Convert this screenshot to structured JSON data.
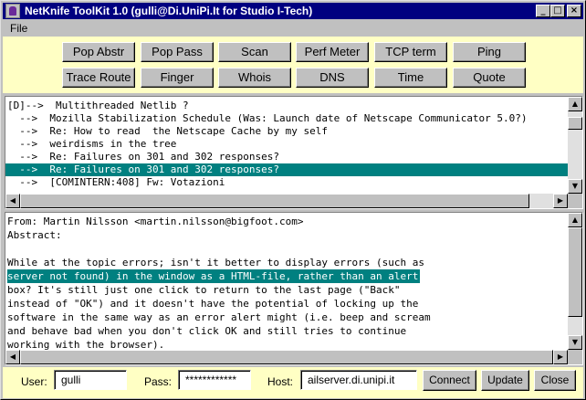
{
  "window": {
    "title": "NetKnife ToolKit 1.0 (gulli@Di.UniPi.It for Studio I-Tech)",
    "minimize_glyph": "_",
    "maximize_glyph": "□",
    "close_glyph": "×"
  },
  "menu": {
    "file": "File"
  },
  "toolbar": {
    "row1": [
      "Pop Abstr",
      "Pop Pass",
      "Scan",
      "Perf Meter",
      "TCP term",
      "Ping"
    ],
    "row2": [
      "Trace Route",
      "Finger",
      "Whois",
      "DNS",
      "Time",
      "Quote"
    ]
  },
  "message_list": {
    "selected_index": 5,
    "items": [
      "[D]-->  Multithreaded Netlib ?",
      "  -->  Mozilla Stabilization Schedule (Was: Launch date of Netscape Communicator 5.0?)",
      "  -->  Re: How to read  the Netscape Cache by my self",
      "  -->  weirdisms in the tree",
      "  -->  Re: Failures on 301 and 302 responses?",
      "  -->  Re: Failures on 301 and 302 responses?",
      "  -->  [COMINTERN:408] Fw: Votazioni"
    ]
  },
  "message_body": {
    "lines": [
      "From: Martin Nilsson <martin.nilsson@bigfoot.com>",
      "Abstract:",
      "",
      "While at the topic errors; isn't it better to display errors (such as",
      "server not found) in the window as a HTML-file, rather than an alert",
      "box? It's still just one click to return to the last page (\"Back\"",
      "instead of \"OK\") and it doesn't have the potential of locking up the",
      "software in the same way as an error alert might (i.e. beep and scream",
      "and behave bad when you don't click OK and still tries to continue",
      "working with the browser)."
    ],
    "highlighted_line": 4
  },
  "connection": {
    "user_label": "User:",
    "user_value": "gulli",
    "pass_label": "Pass:",
    "pass_value": "************",
    "host_label": "Host:",
    "host_value": "ailserver.di.unipi.it",
    "connect_label": "Connect",
    "update_label": "Update",
    "close_label": "Close"
  },
  "colors": {
    "title_bar": "#000080",
    "panel_background": "#ffffc4",
    "selection": "#008080"
  }
}
